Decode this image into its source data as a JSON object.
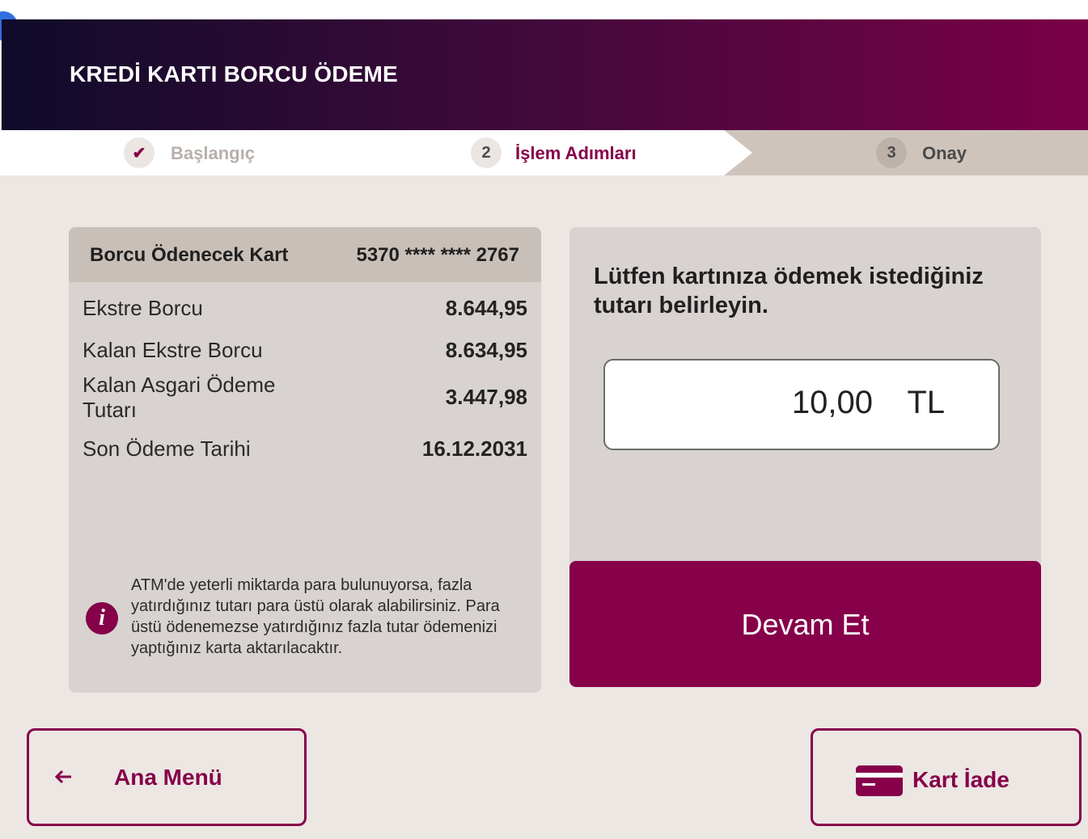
{
  "header": {
    "title": "KREDİ KARTI BORCU ÖDEME"
  },
  "steps": [
    {
      "marker": "✔",
      "label": "Başlangıç"
    },
    {
      "marker": "2",
      "label": "İşlem Adımları"
    },
    {
      "marker": "3",
      "label": "Onay"
    }
  ],
  "card": {
    "title": "Borcu Ödenecek Kart",
    "number": "5370 **** **** 2767",
    "rows": [
      {
        "label": "Ekstre Borcu",
        "value": "8.644,95"
      },
      {
        "label": "Kalan Ekstre Borcu",
        "value": "8.634,95"
      },
      {
        "label": "Kalan Asgari Ödeme Tutarı",
        "value": "3.447,98"
      },
      {
        "label": "Son Ödeme Tarihi",
        "value": "16.12.2031"
      }
    ],
    "info": "ATM'de yeterli miktarda para bulunuyorsa, fazla yatırdığınız tutarı para üstü olarak alabilirsiniz. Para üstü ödenemezse yatırdığınız fazla tutar ödemenizi yaptığınız karta aktarılacaktır."
  },
  "payment": {
    "prompt": "Lütfen kartınıza ödemek istediğiniz tutarı belirleyin.",
    "amount": "10,00",
    "currency": "TL",
    "continue_label": "Devam Et"
  },
  "footer": {
    "main_menu_label": "Ana Menü",
    "card_return_label": "Kart İade"
  },
  "colors": {
    "accent": "#86004a",
    "header_start": "#0f0b2a",
    "header_end": "#7a0048",
    "background": "#ece7e3",
    "panel": "#d8d3d0"
  },
  "icons": {
    "back": "arrow-left-icon",
    "card": "credit-card-icon",
    "info": "info-icon",
    "done": "check-icon"
  }
}
